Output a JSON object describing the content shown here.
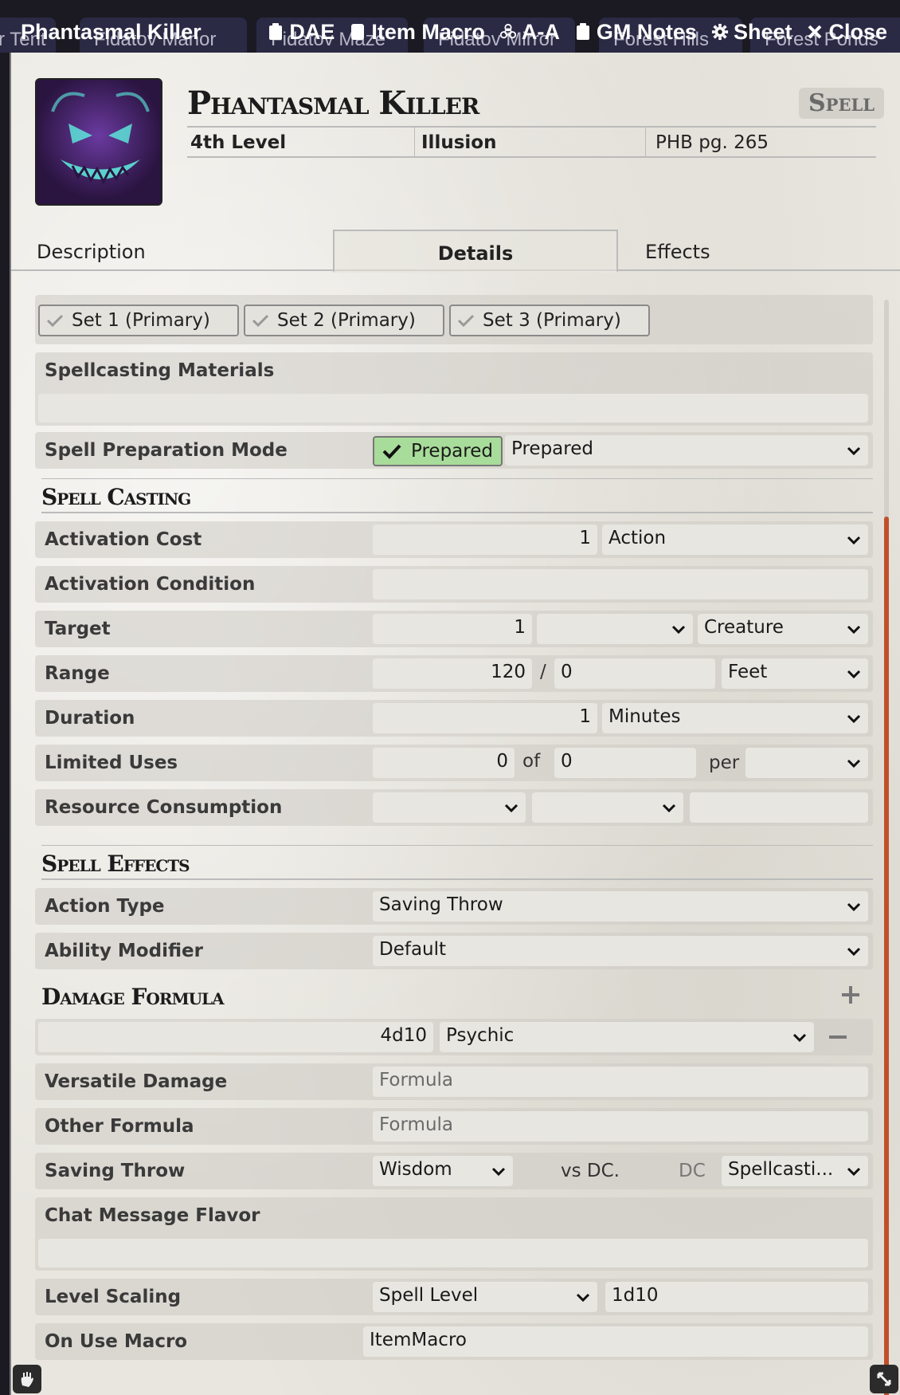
{
  "scene_tabs": [
    "r Tent",
    "Fidatov Manor",
    "Fidatov Maze",
    "Fidatov Mirror",
    "Forest Hills",
    "Forest Ponds"
  ],
  "window": {
    "title": "Phantasmal Killer",
    "controls": {
      "dae": "DAE",
      "item_macro": "Item Macro",
      "aa": "A-A",
      "gm_notes": "GM Notes",
      "sheet": "Sheet",
      "close": "Close"
    }
  },
  "header": {
    "name": "Phantasmal Killer",
    "badge": "Spell",
    "level": "4th Level",
    "school": "Illusion",
    "source": "PHB pg. 265"
  },
  "tabs": {
    "description": "Description",
    "details": "Details",
    "effects": "Effects"
  },
  "sets": [
    "Set 1 (Primary)",
    "Set 2 (Primary)",
    "Set 3 (Primary)"
  ],
  "materials": {
    "label": "Spellcasting Materials",
    "value": ""
  },
  "preparation": {
    "label": "Spell Preparation Mode",
    "chip": "Prepared",
    "mode": "Prepared"
  },
  "spell_casting": {
    "heading": "Spell Casting",
    "activation_cost": {
      "label": "Activation Cost",
      "value": "1",
      "unit": "Action"
    },
    "activation_condition": {
      "label": "Activation Condition",
      "value": ""
    },
    "target": {
      "label": "Target",
      "value": "1",
      "units": "",
      "type": "Creature"
    },
    "range": {
      "label": "Range",
      "value": "120",
      "sep": "/",
      "long": "0",
      "unit": "Feet"
    },
    "duration": {
      "label": "Duration",
      "value": "1",
      "unit": "Minutes"
    },
    "limited_uses": {
      "label": "Limited Uses",
      "value": "0",
      "of": "of",
      "max": "0",
      "per": "per",
      "per_value": ""
    },
    "resource_consumption": {
      "label": "Resource Consumption",
      "type": "",
      "target": "",
      "amount": ""
    }
  },
  "spell_effects": {
    "heading": "Spell Effects",
    "action_type": {
      "label": "Action Type",
      "value": "Saving Throw"
    },
    "ability_modifier": {
      "label": "Ability Modifier",
      "value": "Default"
    }
  },
  "damage": {
    "heading": "Damage Formula",
    "formula": "4d10",
    "type": "Psychic",
    "versatile": {
      "label": "Versatile Damage",
      "placeholder": "Formula"
    },
    "other": {
      "label": "Other Formula",
      "placeholder": "Formula"
    },
    "saving_throw": {
      "label": "Saving Throw",
      "ability": "Wisdom",
      "vs": "vs DC.",
      "dc": "DC",
      "scaling": "Spellcasti..."
    },
    "chat_flavor": {
      "label": "Chat Message Flavor",
      "value": ""
    },
    "level_scaling": {
      "label": "Level Scaling",
      "mode": "Spell Level",
      "formula": "1d10"
    },
    "on_use_macro": {
      "label": "On Use Macro",
      "value": "ItemMacro"
    }
  }
}
